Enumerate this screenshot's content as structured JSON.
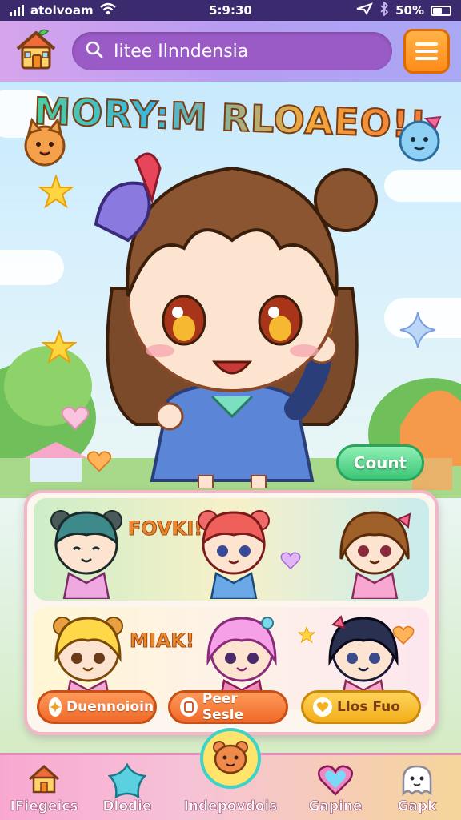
{
  "status_bar": {
    "carrier": "atolvoam",
    "time": "5:9:30",
    "battery": "50%",
    "battery_level": 0.5
  },
  "header": {
    "search_value": "Iitee Ilnndensia"
  },
  "hero": {
    "title": "MORY:M RLOAEO!!",
    "count_button": "Count"
  },
  "roster": {
    "row_1_label": "FOVKI!",
    "row_2_label": "MIAK!",
    "buttons": [
      {
        "label": "Duennoioin",
        "icon": "sparkle-icon"
      },
      {
        "label": "Peer Sesle",
        "icon": "card-icon"
      },
      {
        "label": "Llos Fuo",
        "icon": "heart-icon"
      }
    ]
  },
  "bottom_nav": {
    "items": [
      {
        "label": "IFiegeics",
        "icon": "house-icon"
      },
      {
        "label": "Dlodie",
        "icon": "star-icon"
      },
      {
        "label": "Indepovdois",
        "icon": "bear-face-icon"
      },
      {
        "label": "Gapine",
        "icon": "heart-icon"
      },
      {
        "label": "Gapk",
        "icon": "ghost-icon"
      }
    ]
  },
  "colors": {
    "status_bar": "#3b2a6e",
    "search_bg": "#9a5bc7",
    "menu_button": "#ff8c1a",
    "count_button": "#3cc678",
    "panel_border": "#f2b7c6"
  }
}
